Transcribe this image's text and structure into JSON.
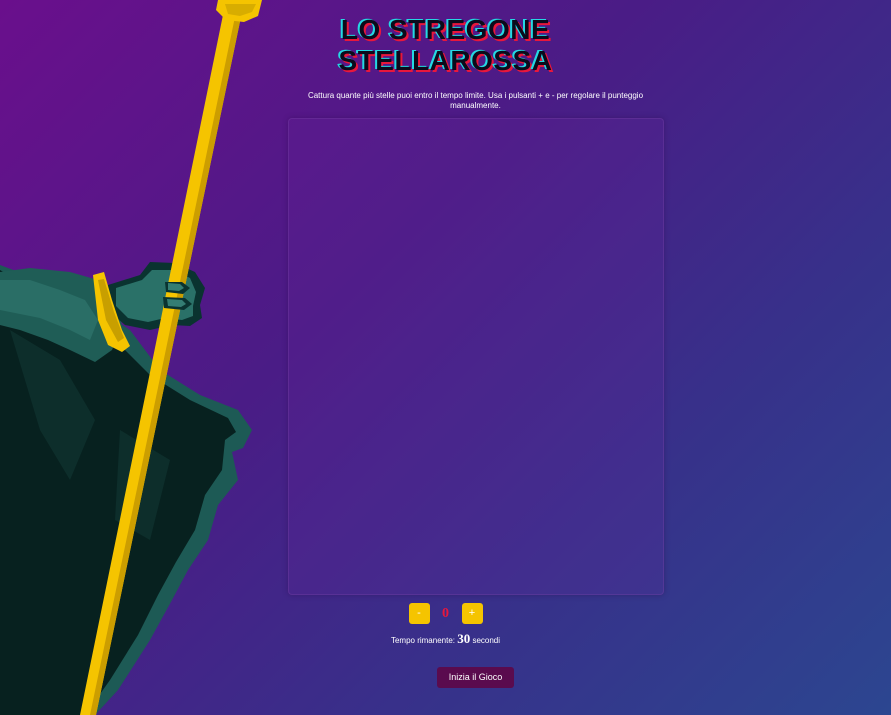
{
  "game": {
    "title_line1": "LO STREGONE",
    "title_line2": "STELLAROSSA",
    "instructions": "Cattura quante più stelle puoi entro il tempo limite. Usa i pulsanti + e - per regolare il punteggio manualmente."
  },
  "score": {
    "minus_label": "-",
    "value": "0",
    "plus_label": "+"
  },
  "timer": {
    "prefix": "Tempo rimanente:",
    "seconds": "30",
    "suffix": "secondi"
  },
  "start_button": {
    "label": "Inizia il Gioco"
  },
  "colors": {
    "accent_yellow": "#f5c400",
    "score_red": "#e8173c",
    "start_button": "#5a0b4e",
    "title_cyan": "#25d8e3"
  }
}
